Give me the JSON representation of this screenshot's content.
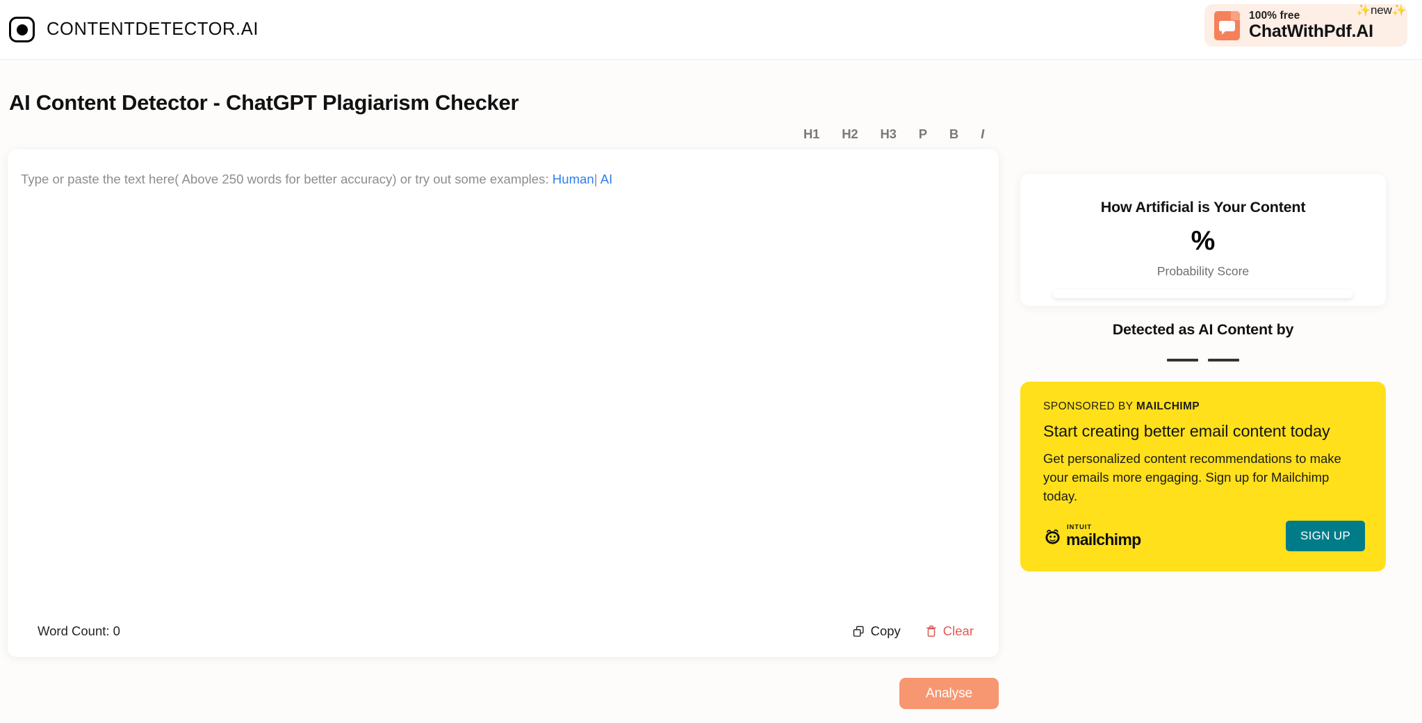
{
  "header": {
    "brand_name": "CONTENTDETECTOR.AI",
    "logo_icon": "circle-in-square-logo",
    "promo": {
      "icon": "pdf-chat-icon",
      "small_text": "100% free",
      "title": "ChatWithPdf.AI",
      "badge": "✨new✨"
    }
  },
  "page": {
    "title": "AI Content Detector - ChatGPT Plagiarism Checker"
  },
  "toolbar": {
    "buttons": [
      {
        "label": "H1",
        "name": "format-h1"
      },
      {
        "label": "H2",
        "name": "format-h2"
      },
      {
        "label": "H3",
        "name": "format-h3"
      },
      {
        "label": "P",
        "name": "format-paragraph"
      },
      {
        "label": "B",
        "name": "format-bold"
      },
      {
        "label": "I",
        "name": "format-italic"
      }
    ]
  },
  "editor": {
    "placeholder_text": "Type or paste the text here( Above 250 words for better accuracy) or try out some examples:",
    "example_human": "Human",
    "example_separator": "|",
    "example_ai": "AI",
    "value": "",
    "word_count_label": "Word Count: 0",
    "copy_label": "Copy",
    "copy_icon": "copy-icon",
    "clear_label": "Clear",
    "clear_icon": "trash-icon",
    "clear_color": "#e05a52"
  },
  "score_card": {
    "title": "How Artificial is Your Content",
    "value": "%",
    "label": "Probability Score",
    "progress_percent": 0
  },
  "detected": {
    "title": "Detected as AI Content by",
    "placeholder_dashes": 2
  },
  "ad": {
    "sponsored_prefix": "SPONSORED BY",
    "sponsored_brand": "MAILCHIMP",
    "headline": "Start creating better email content today",
    "body": "Get personalized content recommendations to make your emails more engaging. Sign up for Mailchimp today.",
    "logo_top": "INTUIT",
    "logo_name": "mailchimp",
    "logo_icon": "mailchimp-monkey-icon",
    "cta_label": "SIGN UP",
    "background_color": "#ffe01b",
    "cta_color": "#007c89"
  },
  "actions": {
    "analyse_label": "Analyse",
    "analyse_color": "#f79771"
  }
}
